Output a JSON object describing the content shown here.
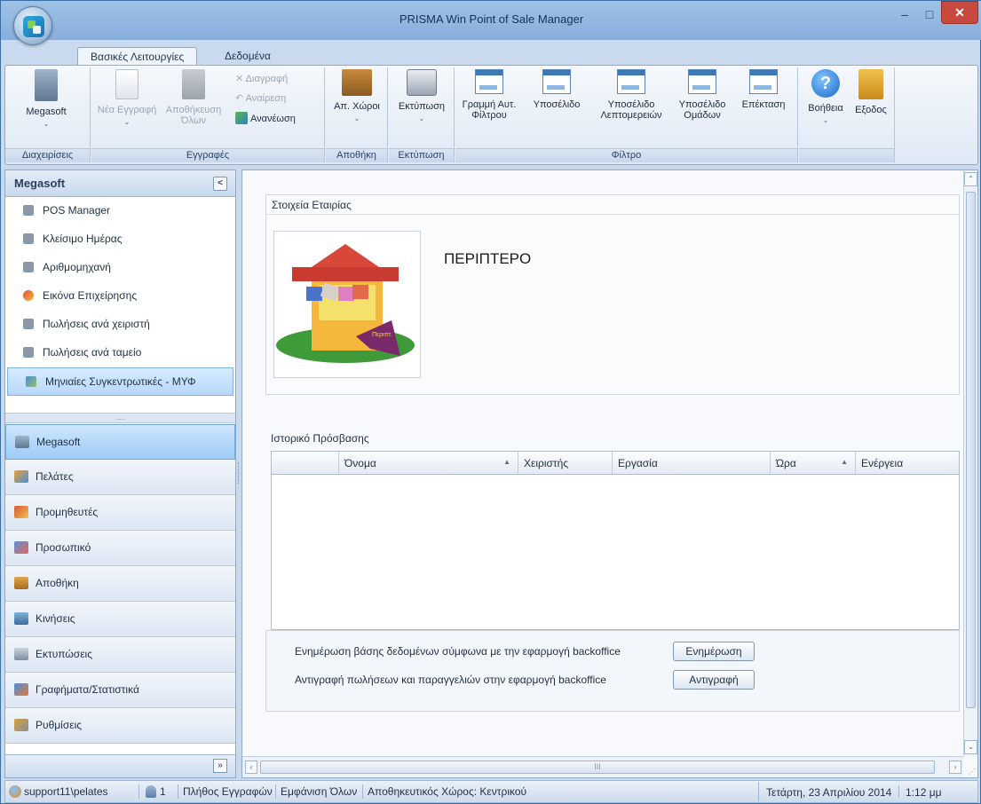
{
  "window": {
    "title": "PRISMA Win Point of Sale Manager",
    "minimize": "–",
    "maximize": "□",
    "close": "✕"
  },
  "ribbon": {
    "tabs": [
      "Βασικές Λειτουργίες",
      "Δεδομένα"
    ],
    "groups": {
      "management": "Διαχειρίσεις",
      "records": "Εγγραφές",
      "storage": "Αποθήκη",
      "printing": "Εκτύπωση",
      "filter": "Φίλτρο"
    },
    "buttons": {
      "megasoft": "Megasoft",
      "new_record": "Νέα Εγγραφή",
      "save_all_1": "Αποθήκευση",
      "save_all_2": "Όλων",
      "delete": "Διαγραφή",
      "undo": "Αναίρεση",
      "refresh": "Ανανέωση",
      "storage_places": "Απ. Χώροι",
      "print": "Εκτύπωση",
      "filter_row_1": "Γραμμή Αυτ.",
      "filter_row_2": "Φίλτρου",
      "subview": "Υποσέλιδο",
      "subview_details_1": "Υποσέλιδο",
      "subview_details_2": "Λεπτομερειών",
      "subview_groups_1": "Υποσέλιδο",
      "subview_groups_2": "Ομάδων",
      "expand": "Επέκταση",
      "help": "Βοήθεια",
      "exit": "Εξοδος"
    }
  },
  "sidebar": {
    "header": "Megasoft",
    "collapse": "<",
    "expand": "»",
    "splitter": ".....",
    "items": [
      {
        "label": "POS Manager"
      },
      {
        "label": "Κλείσιμο Ημέρας"
      },
      {
        "label": "Αριθμομηχανή"
      },
      {
        "label": "Εικόνα Επιχείρησης"
      },
      {
        "label": "Πωλήσεις ανά χειριστή"
      },
      {
        "label": "Πωλήσεις ανά ταμείο"
      },
      {
        "label": "Μηνιαίες Συγκεντρωτικές - ΜΥΦ"
      }
    ],
    "groups": [
      {
        "label": "Megasoft"
      },
      {
        "label": "Πελάτες"
      },
      {
        "label": "Προμηθευτές"
      },
      {
        "label": "Προσωπικό"
      },
      {
        "label": "Αποθήκη"
      },
      {
        "label": "Κινήσεις"
      },
      {
        "label": "Εκτυπώσεις"
      },
      {
        "label": "Γραφήματα/Στατιστικά"
      },
      {
        "label": "Ρυθμίσεις"
      }
    ]
  },
  "main": {
    "company_panel_title": "Στοιχεία Εταιρίας",
    "company_name": "ΠΕΡΙΠΤΕΡΟ",
    "kiosk_sign": "Περιπτ.",
    "history_panel_title": "Ιστορικό Πρόσβασης",
    "columns": [
      "Όνομα",
      "Χειριστής",
      "Εργασία",
      "Ώρα",
      "Ενέργεια"
    ],
    "sync_db_text": "Ενημέρωση βάσης δεδομένων σύμφωνα με την εφαρμογή backoffice",
    "sync_db_button": "Ενημέρωση",
    "copy_sales_text": "Αντιγραφή πωλήσεων και παραγγελιών στην εφαρμογή backoffice",
    "copy_sales_button": "Αντιγραφή",
    "hscroll_grip": "III"
  },
  "status": {
    "user": "support11\\pelates",
    "count_value": "1",
    "records_label": "Πλήθος Εγγραφών",
    "show_all": "Εμφάνιση Όλων",
    "storage_label": "Αποθηκευτικός Χώρος: Κεντρικού",
    "date": "Τετάρτη, 23 Απριλίου 2014",
    "time": "1:12 μμ"
  },
  "colors": {
    "accent": "#3d78b8",
    "close_button": "#c84a3f",
    "selected_item": "#b7d8fb"
  },
  "icons": {
    "app": "prisma-logo-icon",
    "help": "help-icon",
    "exit": "exit-door-icon"
  }
}
